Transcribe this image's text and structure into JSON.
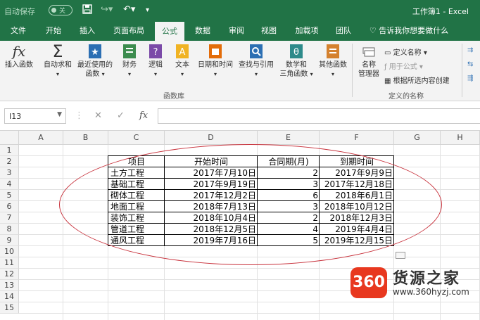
{
  "titlebar": {
    "autosave_label": "自动保存",
    "autosave_state": "关",
    "title": "工作簿1 - Excel"
  },
  "tabs": [
    "文件",
    "开始",
    "插入",
    "页面布局",
    "公式",
    "数据",
    "审阅",
    "视图",
    "加载项",
    "团队"
  ],
  "active_tab": "公式",
  "tell_me": "告诉我你想要做什么",
  "ribbon": {
    "insert_function": "插入函数",
    "autosum": "自动求和",
    "recent_1": "最近使用的",
    "recent_2": "函数",
    "financial": "财务",
    "logical": "逻辑",
    "text": "文本",
    "datetime": "日期和时间",
    "lookup": "查找与引用",
    "math_1": "数学和",
    "math_2": "三角函数",
    "more": "其他函数",
    "group_library": "函数库",
    "name_manager_1": "名称",
    "name_manager_2": "管理器",
    "define_name": "定义名称",
    "use_in_formula": "用于公式",
    "create_from_sel": "根据所选内容创建",
    "group_defined": "定义的名称",
    "colors": {
      "datetime": "#e36c09",
      "financial": "#3c8c4e",
      "logical": "#7b4aa8",
      "text": "#f0b323",
      "lookup": "#2c6fb3",
      "math": "#2d8a8a",
      "more": "#d4812f",
      "recent": "#2c6fb3"
    }
  },
  "formula_bar": {
    "name_box": "I13",
    "cancel": "✕",
    "enter": "✓",
    "fx": "fx"
  },
  "sheet": {
    "columns": [
      "A",
      "B",
      "C",
      "D",
      "E",
      "F",
      "G",
      "H"
    ],
    "rows": [
      "1",
      "2",
      "3",
      "4",
      "5",
      "6",
      "7",
      "8",
      "9",
      "10",
      "11",
      "12",
      "13",
      "14",
      "15"
    ],
    "table_header": [
      "项目",
      "开始时间",
      "合同期(月)",
      "到期时间"
    ],
    "table_rows": [
      [
        "土方工程",
        "2017年7月10日",
        "2",
        "2017年9月9日"
      ],
      [
        "基础工程",
        "2017年9月19日",
        "3",
        "2017年12月18日"
      ],
      [
        "砌体工程",
        "2017年12月2日",
        "6",
        "2018年6月1日"
      ],
      [
        "地面工程",
        "2018年7月13日",
        "3",
        "2018年10月12日"
      ],
      [
        "装饰工程",
        "2018年10月4日",
        "2",
        "2018年12月3日"
      ],
      [
        "管道工程",
        "2018年12月5日",
        "4",
        "2019年4月4日"
      ],
      [
        "通风工程",
        "2019年7月16日",
        "5",
        "2019年12月15日"
      ]
    ]
  },
  "watermark": {
    "badge": "360",
    "name": "货源之家",
    "url": "www.360hyzj.com"
  }
}
